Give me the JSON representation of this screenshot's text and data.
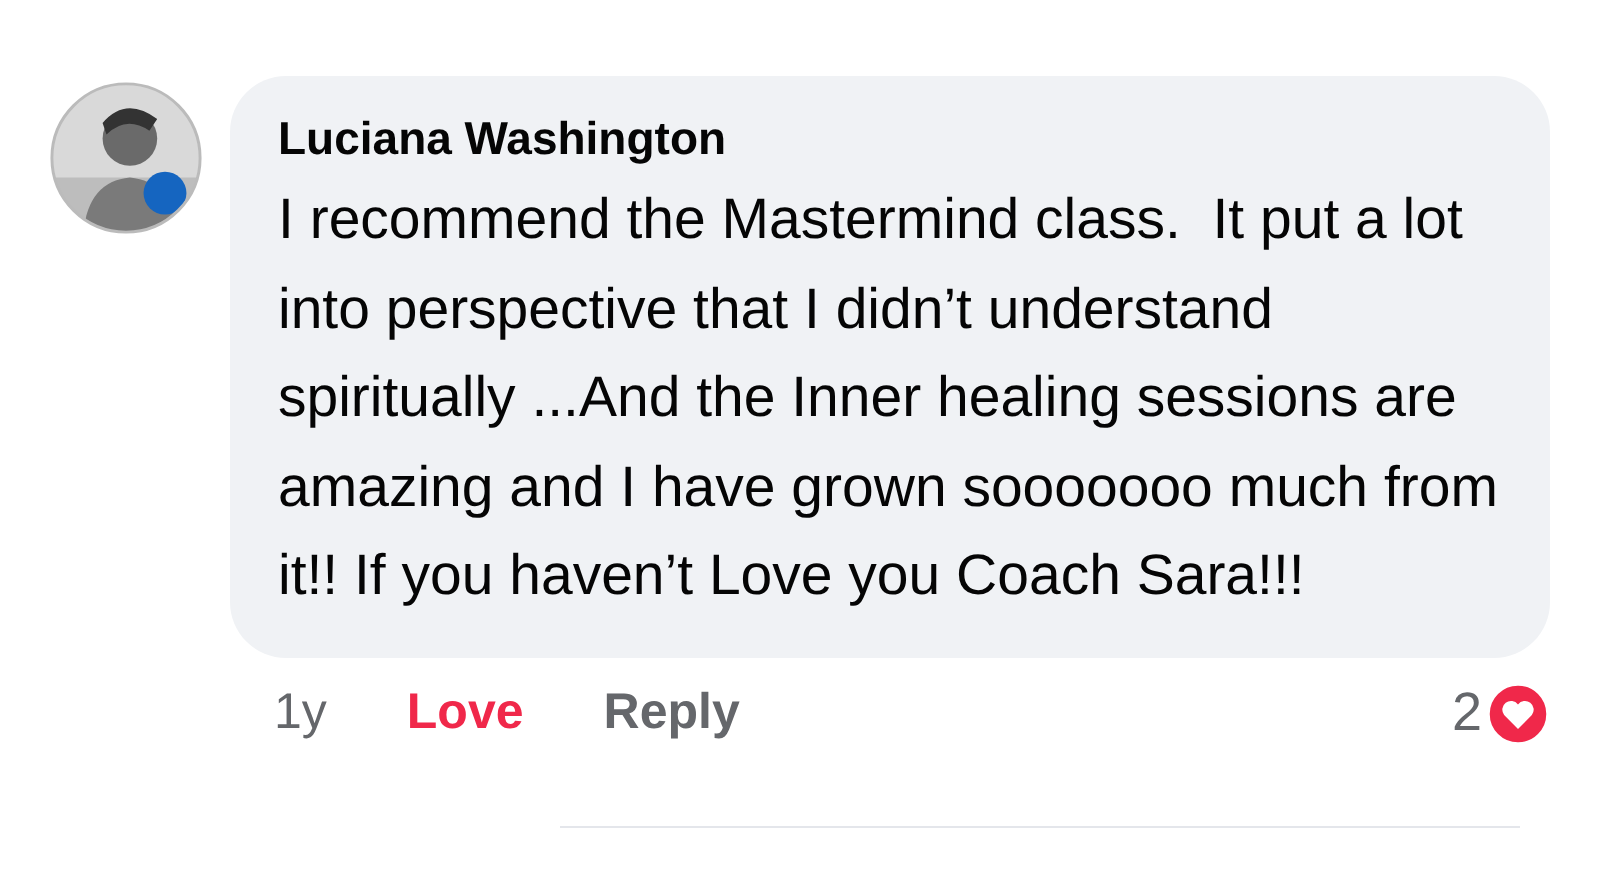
{
  "comment": {
    "author": "Luciana Washington",
    "text": "I recommend the Mastermind class.  It put a lot into perspective that I didn’t understand spiritually ...And the Inner healing sessions are amazing and I have grown sooooooo much from it!! If you haven’t Love you Coach Sara!!!"
  },
  "actions": {
    "time": "1y",
    "love": {
      "label": "Love",
      "selected": true
    },
    "reply": "Reply"
  },
  "reactions": {
    "count": "2"
  }
}
